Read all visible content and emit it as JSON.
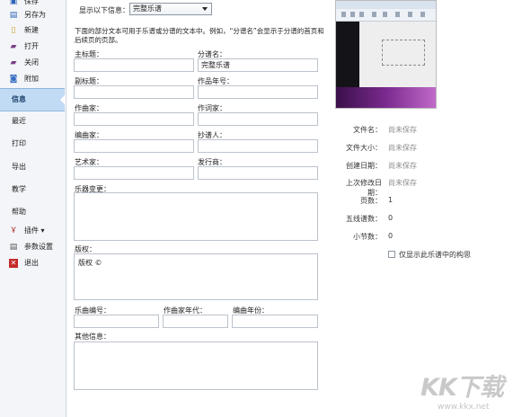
{
  "sidebar": {
    "items": [
      {
        "label": "保存",
        "icon": "save-icon"
      },
      {
        "label": "另存为",
        "icon": "save-as-icon"
      },
      {
        "label": "新建",
        "icon": "new-file-icon"
      },
      {
        "label": "打开",
        "icon": "open-folder-icon"
      },
      {
        "label": "关闭",
        "icon": "close-folder-icon"
      },
      {
        "label": "附加",
        "icon": "attach-icon"
      },
      {
        "label": "信息"
      },
      {
        "label": "最近"
      },
      {
        "label": "打印"
      },
      {
        "label": "导出"
      },
      {
        "label": "教学"
      },
      {
        "label": "帮助"
      },
      {
        "label": "插件 ▾",
        "icon": "plugin-icon"
      },
      {
        "label": "参数设置",
        "icon": "preferences-icon"
      },
      {
        "label": "退出",
        "icon": "exit-icon"
      }
    ]
  },
  "form": {
    "show_label": "显示以下信息：",
    "show_value": "完整乐谱",
    "description": "下面的部分文本可用于乐谱或分谱的文本中。例如，“分谱名”会显示于分谱的首页和后续页的页部。",
    "fields": {
      "main_title": {
        "label": "主标题：",
        "value": ""
      },
      "part_name": {
        "label": "分谱名：",
        "value": "完整乐谱"
      },
      "subtitle": {
        "label": "副标题：",
        "value": ""
      },
      "work_year": {
        "label": "作品年号：",
        "value": ""
      },
      "composer": {
        "label": "作曲家：",
        "value": ""
      },
      "lyricist": {
        "label": "作词家：",
        "value": ""
      },
      "arranger": {
        "label": "编曲家：",
        "value": ""
      },
      "copyist": {
        "label": "抄谱人：",
        "value": ""
      },
      "artist": {
        "label": "艺术家：",
        "value": ""
      },
      "publisher": {
        "label": "发行商：",
        "value": ""
      },
      "instrument_changes": {
        "label": "乐器变更：",
        "value": ""
      },
      "copyright": {
        "label": "版权：",
        "value": "版权 ©"
      },
      "opus_number": {
        "label": "乐曲编号：",
        "value": ""
      },
      "composer_dates": {
        "label": "作曲家年代：",
        "value": ""
      },
      "arrangement_year": {
        "label": "编曲年份：",
        "value": ""
      },
      "other_info": {
        "label": "其他信息：",
        "value": ""
      }
    }
  },
  "info_panel": {
    "rows": [
      {
        "label": "文件名：",
        "value": "尚未保存"
      },
      {
        "label": "文件大小：",
        "value": "尚未保存"
      },
      {
        "label": "创建日期：",
        "value": "尚未保存"
      },
      {
        "label": "上次修改日期：",
        "value": "尚未保存"
      },
      {
        "label": "页数：",
        "value": "1"
      },
      {
        "label": "五线谱数：",
        "value": "0"
      },
      {
        "label": "小节数：",
        "value": "0"
      }
    ],
    "checkbox_label": "仅显示此乐谱中的构思",
    "checkbox_checked": false
  },
  "watermark": {
    "brand": "KK下载",
    "url": "www.kkx.net"
  },
  "colors": {
    "sidebar_bg": "#f3f5f8",
    "active_item": "#c2dbf5",
    "field_border": "#bcc3cc",
    "muted_text": "#8a8a8a"
  }
}
